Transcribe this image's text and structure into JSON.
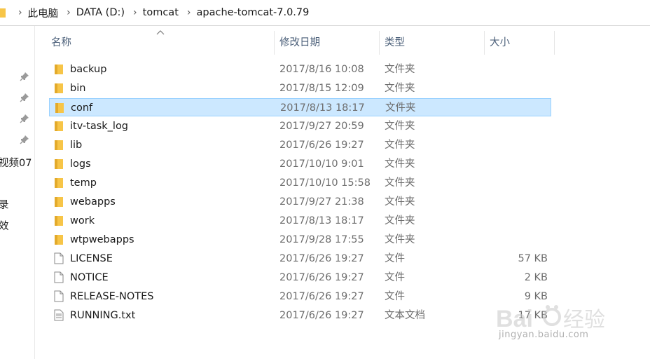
{
  "breadcrumb": {
    "items": [
      "此电脑",
      "DATA (D:)",
      "tomcat",
      "apache-tomcat-7.0.79"
    ]
  },
  "nav": {
    "partial_labels": [
      "视频07",
      "录",
      "效"
    ]
  },
  "columns": {
    "name": "名称",
    "date": "修改日期",
    "type": "类型",
    "size": "大小"
  },
  "files": [
    {
      "name": "backup",
      "date": "2017/8/16 10:08",
      "type": "文件夹",
      "size": "",
      "kind": "folder"
    },
    {
      "name": "bin",
      "date": "2017/8/15 12:09",
      "type": "文件夹",
      "size": "",
      "kind": "folder"
    },
    {
      "name": "conf",
      "date": "2017/8/13 18:17",
      "type": "文件夹",
      "size": "",
      "kind": "folder",
      "selected": true
    },
    {
      "name": "itv-task_log",
      "date": "2017/9/27 20:59",
      "type": "文件夹",
      "size": "",
      "kind": "folder"
    },
    {
      "name": "lib",
      "date": "2017/6/26 19:27",
      "type": "文件夹",
      "size": "",
      "kind": "folder"
    },
    {
      "name": "logs",
      "date": "2017/10/10 9:01",
      "type": "文件夹",
      "size": "",
      "kind": "folder"
    },
    {
      "name": "temp",
      "date": "2017/10/10 15:58",
      "type": "文件夹",
      "size": "",
      "kind": "folder"
    },
    {
      "name": "webapps",
      "date": "2017/9/27 21:38",
      "type": "文件夹",
      "size": "",
      "kind": "folder"
    },
    {
      "name": "work",
      "date": "2017/8/13 18:17",
      "type": "文件夹",
      "size": "",
      "kind": "folder"
    },
    {
      "name": "wtpwebapps",
      "date": "2017/9/28 17:55",
      "type": "文件夹",
      "size": "",
      "kind": "folder"
    },
    {
      "name": "LICENSE",
      "date": "2017/6/26 19:27",
      "type": "文件",
      "size": "57 KB",
      "kind": "file"
    },
    {
      "name": "NOTICE",
      "date": "2017/6/26 19:27",
      "type": "文件",
      "size": "2 KB",
      "kind": "file"
    },
    {
      "name": "RELEASE-NOTES",
      "date": "2017/6/26 19:27",
      "type": "文件",
      "size": "9 KB",
      "kind": "file"
    },
    {
      "name": "RUNNING.txt",
      "date": "2017/6/26 19:27",
      "type": "文本文档",
      "size": "17 KB",
      "kind": "text"
    }
  ],
  "watermark": {
    "text": "jingyan.baidu.com"
  },
  "colors": {
    "folder": "#f7c548",
    "selection_bg": "#cce8ff",
    "selection_border": "#99d1ff",
    "header_text": "#4c607a"
  }
}
